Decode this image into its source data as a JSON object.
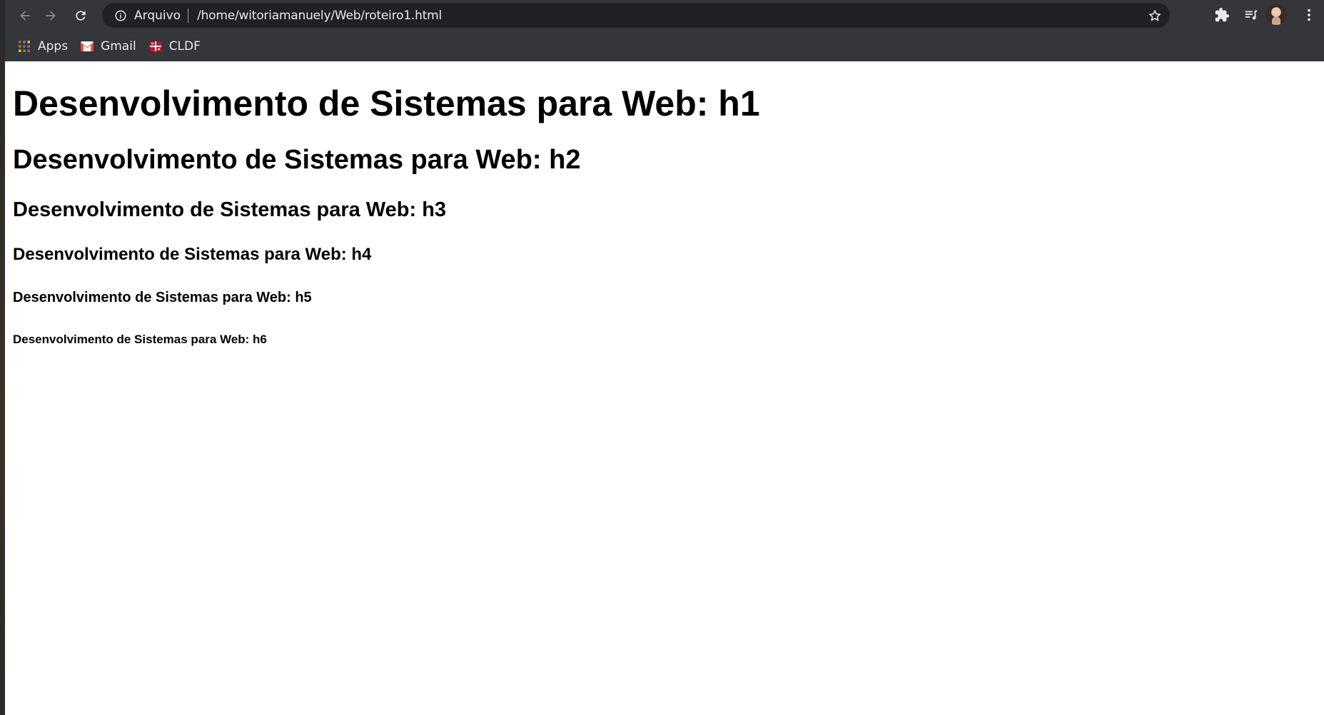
{
  "browser": {
    "omnibox": {
      "scheme_label": "Arquivo",
      "url": "/home/witoriamanuely/Web/roteiro1.html"
    },
    "bookmarks": [
      {
        "label": "Apps",
        "icon": "apps-grid-icon"
      },
      {
        "label": "Gmail",
        "icon": "gmail-icon"
      },
      {
        "label": "CLDF",
        "icon": "cldf-icon"
      }
    ]
  },
  "page": {
    "h1": "Desenvolvimento de Sistemas para Web: h1",
    "h2": "Desenvolvimento de Sistemas para Web: h2",
    "h3": "Desenvolvimento de Sistemas para Web: h3",
    "h4": "Desenvolvimento de Sistemas para Web: h4",
    "h5": "Desenvolvimento de Sistemas para Web: h5",
    "h6": "Desenvolvimento de Sistemas para Web: h6"
  },
  "colors": {
    "chrome_background": "#35363a",
    "omnibox_background": "#202124",
    "chrome_text": "#e8eaed",
    "page_background": "#ffffff",
    "gmail_red": "#ea4335"
  }
}
